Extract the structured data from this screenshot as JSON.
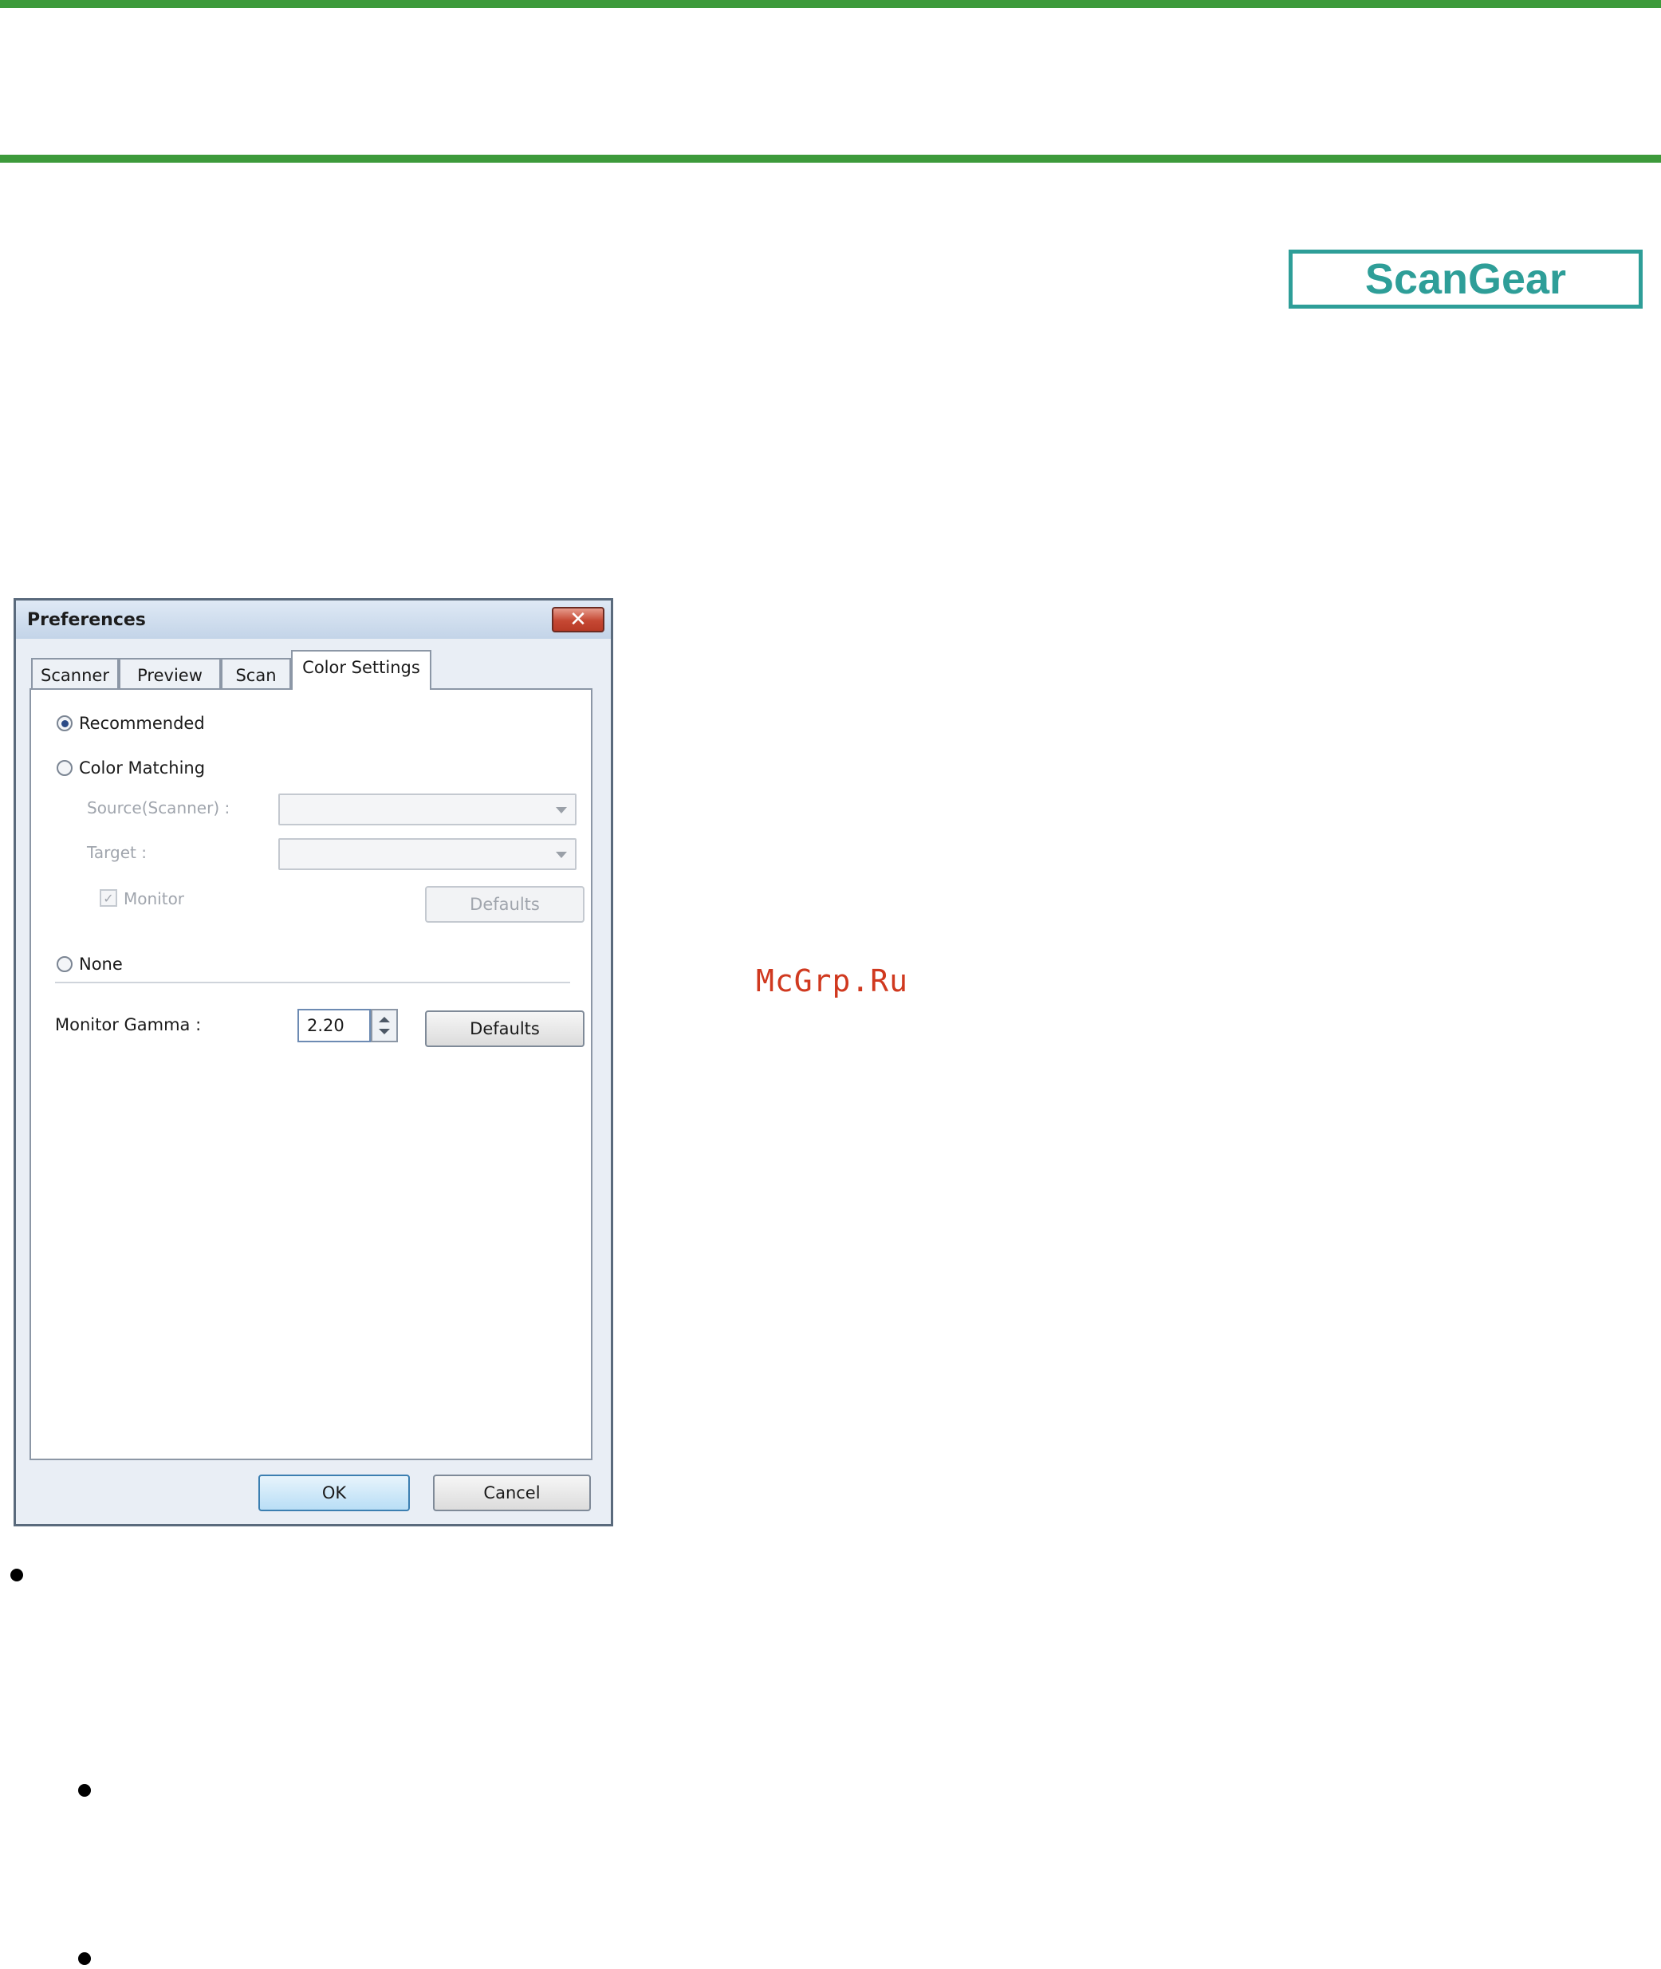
{
  "page": {
    "brand_label": "ScanGear",
    "watermark": "McGrp.Ru"
  },
  "dialog": {
    "title": "Preferences",
    "close_glyph": "✕",
    "tabs": [
      "Scanner",
      "Preview",
      "Scan",
      "Color Settings"
    ],
    "active_tab": "Color Settings",
    "options": {
      "recommended": "Recommended",
      "color_matching": "Color Matching",
      "none": "None",
      "selected": "Recommended"
    },
    "color_matching": {
      "source_label": "Source(Scanner) :",
      "source_value": "",
      "target_label": "Target :",
      "target_value": "",
      "monitor_label": "Monitor",
      "monitor_checked": true,
      "defaults_label": "Defaults"
    },
    "gamma": {
      "label": "Monitor Gamma :",
      "value": "2.20",
      "defaults_label": "Defaults"
    },
    "buttons": {
      "ok": "OK",
      "cancel": "Cancel"
    }
  },
  "icons": [
    "close-icon",
    "radio-icon",
    "checkbox-icon",
    "dropdown-arrow-icon",
    "spinner-up-icon",
    "spinner-down-icon",
    "bullet-icon"
  ],
  "colors": {
    "rule_green": "#3d9a3b",
    "brand_teal": "#2e9e98",
    "watermark_red": "#d0391f"
  }
}
